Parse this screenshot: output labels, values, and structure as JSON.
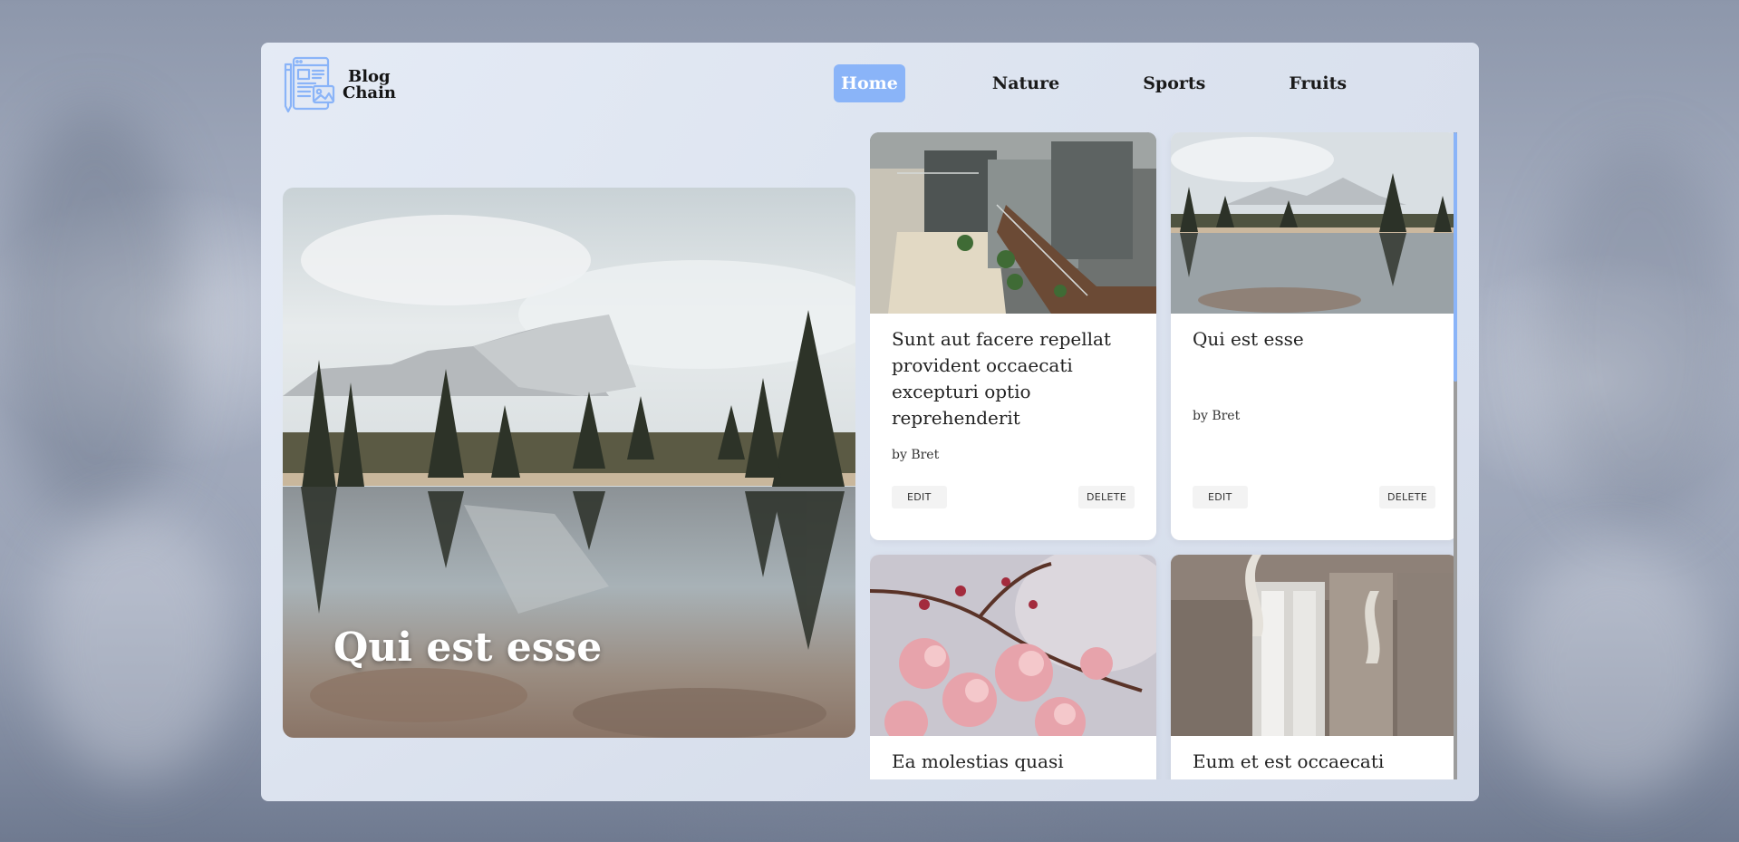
{
  "brand": {
    "line1": "Blog",
    "line2": "Chain"
  },
  "nav": {
    "items": [
      {
        "label": "Home",
        "active": true
      },
      {
        "label": "Nature",
        "active": false
      },
      {
        "label": "Sports",
        "active": false
      },
      {
        "label": "Fruits",
        "active": false
      }
    ]
  },
  "hero": {
    "title": "Qui est esse",
    "image_icon": "mountain-lake-photo"
  },
  "cards": [
    {
      "title": "Sunt aut facere repellat provident occaecati excepturi optio reprehenderit",
      "author": "by Bret",
      "edit_label": "EDIT",
      "delete_label": "DELETE",
      "image_icon": "building-interior-photo"
    },
    {
      "title": "Qui est esse",
      "author": "by Bret",
      "edit_label": "EDIT",
      "delete_label": "DELETE",
      "image_icon": "mountain-lake-photo"
    },
    {
      "title": "Ea molestias quasi",
      "image_icon": "cherry-blossom-photo"
    },
    {
      "title": "Eum et est occaecati",
      "image_icon": "window-interior-photo"
    }
  ],
  "colors": {
    "accent": "#8ab4f8",
    "panel": "#e3e9f4",
    "card": "#ffffff"
  }
}
